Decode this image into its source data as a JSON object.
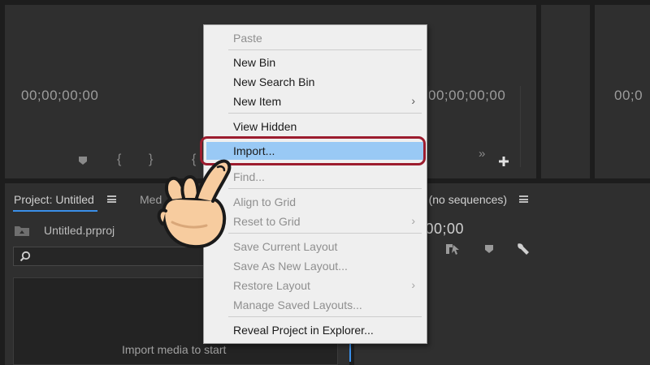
{
  "source_monitor": {
    "timecode": "00;00;00;00"
  },
  "program_monitor": {
    "timecode": "00;00;00;00"
  },
  "third_monitor": {
    "timecode": "00;0"
  },
  "project_panel": {
    "tab_label": "Project: Untitled",
    "second_tab_label": "Med",
    "file_name": "Untitled.prproj",
    "search_placeholder": "",
    "empty_message": "Import media to start"
  },
  "timeline_panel": {
    "tab_label": "e: (no sequences)",
    "timecode": ";00;00"
  },
  "context_menu": {
    "items": [
      {
        "label": "Paste",
        "enabled": false
      },
      {
        "label": "New Bin",
        "enabled": true
      },
      {
        "label": "New Search Bin",
        "enabled": true
      },
      {
        "label": "New Item",
        "enabled": true,
        "submenu": true
      },
      {
        "label": "View Hidden",
        "enabled": true
      },
      {
        "label": "Import...",
        "enabled": true,
        "highlighted": true
      },
      {
        "label": "Find...",
        "enabled": false
      },
      {
        "label": "Align to Grid",
        "enabled": false
      },
      {
        "label": "Reset to Grid",
        "enabled": false,
        "submenu": true
      },
      {
        "label": "Save Current Layout",
        "enabled": false
      },
      {
        "label": "Save As New Layout...",
        "enabled": false
      },
      {
        "label": "Restore Layout",
        "enabled": false,
        "submenu": true
      },
      {
        "label": "Manage Saved Layouts...",
        "enabled": false
      },
      {
        "label": "Reveal Project in Explorer...",
        "enabled": true
      }
    ]
  },
  "icons": {
    "pointer": "pointing-hand-icon",
    "submenu": "chevron-right-icon",
    "folder": "folder-up-icon",
    "search": "magnifier-icon",
    "wrench": "wrench-icon",
    "marker": "marker-icon",
    "add": "plus-icon"
  },
  "colors": {
    "menu_bg": "#efefef",
    "menu_highlight": "#99c9f5",
    "annotation_ring": "#9c1c2e",
    "panel_bg": "#2f2f2f",
    "accent_blue": "#3a8fe8"
  }
}
